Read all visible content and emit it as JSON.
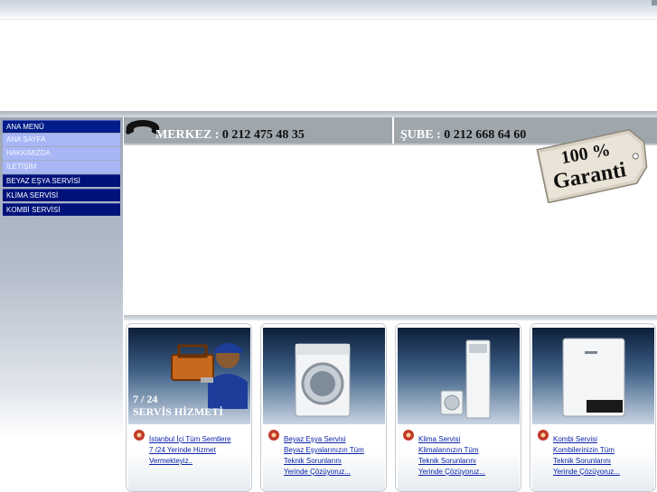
{
  "menu": {
    "header": "ANA MENÜ",
    "sub_items": [
      "ANA SAYFA",
      "HAKKIMIZDA",
      "İLETİŞİM"
    ],
    "links": [
      "BEYAZ EŞYA SERVİSİ",
      "KLİMA SERVİSİ",
      "KOMBİ SERVİSİ"
    ]
  },
  "phones": {
    "merkez_label": "MERKEZ :",
    "merkez_number": "0 212 475 48 35",
    "sube_label": "ŞUBE :",
    "sube_number": "0 212 668 64 60"
  },
  "badge": {
    "line1": "100 %",
    "line2": "Garanti"
  },
  "cards": [
    {
      "title_line1": "7 / 24",
      "title_line2": "SERVİS HİZMETİ",
      "lines": [
        "İstanbul İçi Tüm Semtlere",
        "7 /24 Yerinde Hizmet",
        "Vermekteyiz.."
      ]
    },
    {
      "lines": [
        "Beyaz Eşya Servisi",
        "Beyaz Eşyalarınızın Tüm",
        "Teknik Sorunlarını",
        "Yerinde Çözüyoruz..."
      ]
    },
    {
      "lines": [
        "Klima Servisi",
        "Klimalarınızın  Tüm",
        "Teknik Sorunlarını",
        "Yerinde Çözüyoruz..."
      ]
    },
    {
      "lines": [
        "Kombi Servisi",
        "Kombilerinizin  Tüm",
        "Teknik Sorunlarını",
        "Yerinde Çözüyoruz..."
      ]
    }
  ],
  "colors": {
    "menu_dark": "#001d8a",
    "menu_light": "#a8b6f6",
    "phonebar": "#9fa7ad",
    "link": "#0a23a8"
  }
}
